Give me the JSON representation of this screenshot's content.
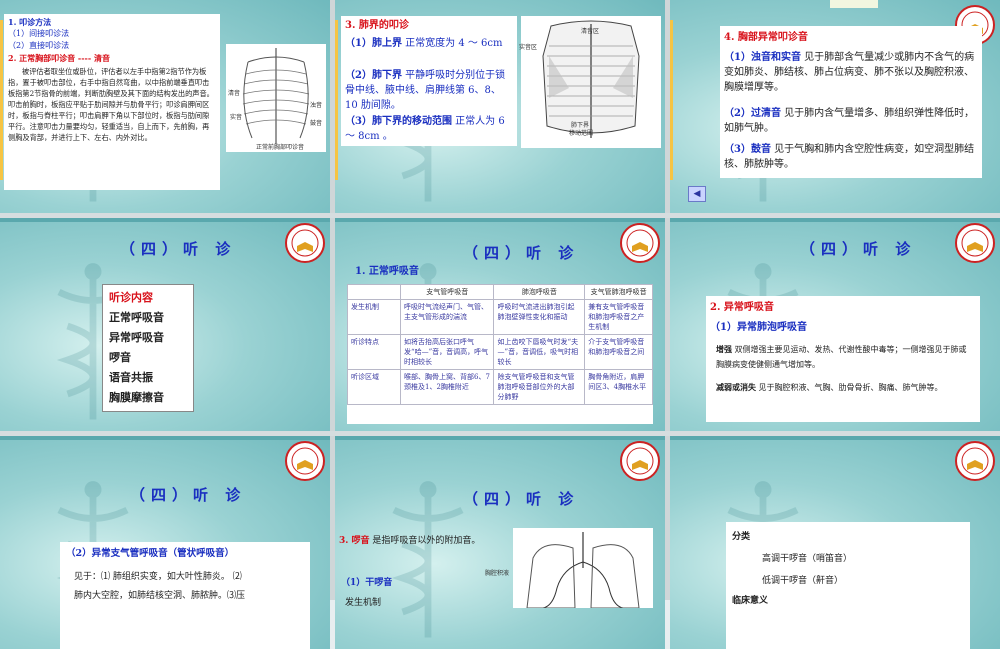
{
  "slide1": {
    "method_title": "1. 叩诊方法",
    "method_1": "（1）间接叩诊法",
    "method_2": "（2）直接叩诊法",
    "normal_title": "2. 正常胸部叩诊音 ---- 清音",
    "paragraph": "被评估者取坐位或卧位，评估者以左手中指第2指节作为板指，置于被叩击部位，右手中指自然弯曲，以中指前端垂直叩击板指第2节指骨的前端，判断肋胸壁及其下面的结构发出的声音。叩击前胸时，板指应平贴于肋间隙并与肋骨平行；叩诊肩胛间区时，板指与脊柱平行；叩击肩胛下角以下部位时，板指与肋间隙平行。注意叩击力量要均匀，轻重适当，自上而下，先前胸，再侧胸及背部，并进行上下、左右、内外对比。",
    "figure_caption": "正常前胸部叩诊音",
    "labels": [
      "清音",
      "浊音",
      "鼓音",
      "实音"
    ]
  },
  "slide2": {
    "heading": "3. 肺界的叩诊",
    "item1_head": "（1）肺上界",
    "item1_text": "正常宽度为 4 ～ 6cm",
    "item2_head": "（2）肺下界",
    "item2_text": "平静呼吸时分别位于锁骨中线、腋中线、肩胛线第 6、8、10 肋间隙。",
    "item3_head": "（3）肺下界的移动范围",
    "item3_text": "正常人为 6 ～ 8cm 。",
    "fig_labels": [
      "清音区",
      "实音区",
      "肺下界",
      "移动范围"
    ]
  },
  "slide3": {
    "heading": "4. 胸部异常叩诊音",
    "item1_head": "（1）浊音和实音",
    "item1_text": "见于肺部含气量减少或肺内不含气的病变如肺炎、肺结核、肺占位病变、肺不张以及胸腔积液、胸膜增厚等。",
    "item2_head": "（2）过清音",
    "item2_text": "见于肺内含气量增多、肺组织弹性降低时，如肺气肿。",
    "item3_head": "（3）鼓音",
    "item3_text": "见于气胸和肺内含空腔性病变，如空洞型肺结核、肺脓肿等。",
    "nav_prev": "◀"
  },
  "slide4": {
    "title": "（四）听 诊",
    "box_title": "听诊内容",
    "items": [
      "正常呼吸音",
      "异常呼吸音",
      "啰音",
      "语音共振",
      "胸膜摩擦音"
    ]
  },
  "slide5": {
    "title": "（四）听 诊",
    "heading": "1. 正常呼吸音",
    "columns": [
      "",
      "支气管呼吸音",
      "肺泡呼吸音",
      "支气管肺泡呼吸音"
    ],
    "rows": [
      [
        "发生机制",
        "呼吸时气流经声门、气管、主支气管形成的湍流",
        "呼吸时气流进出肺泡引起肺泡壁弹性变化和振动",
        "兼有支气管呼吸音和肺泡呼吸音之产生机制"
      ],
      [
        "听诊特点",
        "如将舌抬高后张口呼气发“哈—”音，音调高，呼气时相较长",
        "如上齿咬下唇吸气时发“夫—”音，音调低，吸气时相较长",
        "介于支气管呼吸音和肺泡呼吸音之间"
      ],
      [
        "听诊区域",
        "喉部、胸骨上窝、背部6、7颈椎及1、2胸椎附近",
        "除支气管呼吸音和支气管肺泡呼吸音部位外的大部分肺野",
        "胸骨角附近，肩胛间区3、4胸椎水平"
      ]
    ]
  },
  "slide6": {
    "title": "（四）听 诊",
    "heading": "2. 异常呼吸音",
    "sub": "（1）异常肺泡呼吸音",
    "p1_head": "增强",
    "p1_text": "双侧增强主要见运动、发热、代谢性酸中毒等；一侧增强见于肺或胸膜病变使健侧通气增加等。",
    "p2_head": "减弱或消失",
    "p2_text": "见于胸腔积液、气胸、肋骨骨折、胸痛、肺气肿等。"
  },
  "slide7": {
    "title": "（四）听 诊",
    "heading": "（2）异常支气管呼吸音（管状呼吸音）",
    "line1": "见于：⑴ 肺组织实变，如大叶性肺炎。 ⑵",
    "line2": "肺内大空腔，如肺结核空洞、肺脓肿。⑶压"
  },
  "slide8": {
    "title": "（四）听 诊",
    "heading": "3. 啰音",
    "heading_text": "是指呼吸音以外的附加音。",
    "sub": "（1）干啰音",
    "cut": "发生机制",
    "fig_label": "胸腔积液"
  },
  "slide9": {
    "l1": "分类",
    "l2": "高调干啰音（哨笛音）",
    "l3": "低调干啰音（鼾音）",
    "l4": "临床意义"
  }
}
